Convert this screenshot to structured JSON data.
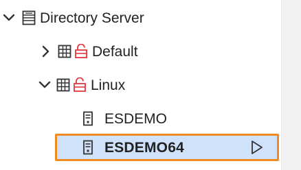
{
  "tree": {
    "root": {
      "label": "Directory Server",
      "expanded": true,
      "icon": "server-list-icon"
    },
    "children": [
      {
        "label": "Default",
        "expanded": false,
        "icons": [
          "server-grid-icon",
          "unlocked-icon"
        ]
      },
      {
        "label": "Linux",
        "expanded": true,
        "icons": [
          "server-grid-icon",
          "unlocked-icon"
        ],
        "children": [
          {
            "label": "ESDEMO",
            "selected": false,
            "icon": "server-tower-icon"
          },
          {
            "label": "ESDEMO64",
            "selected": true,
            "icon": "server-tower-icon",
            "action_icon": "play-icon"
          }
        ]
      }
    ]
  },
  "colors": {
    "selection_fill": "#cfe2fa",
    "selection_border": "#f28a22",
    "lock_icon": "#e5363d",
    "text": "#222222"
  }
}
